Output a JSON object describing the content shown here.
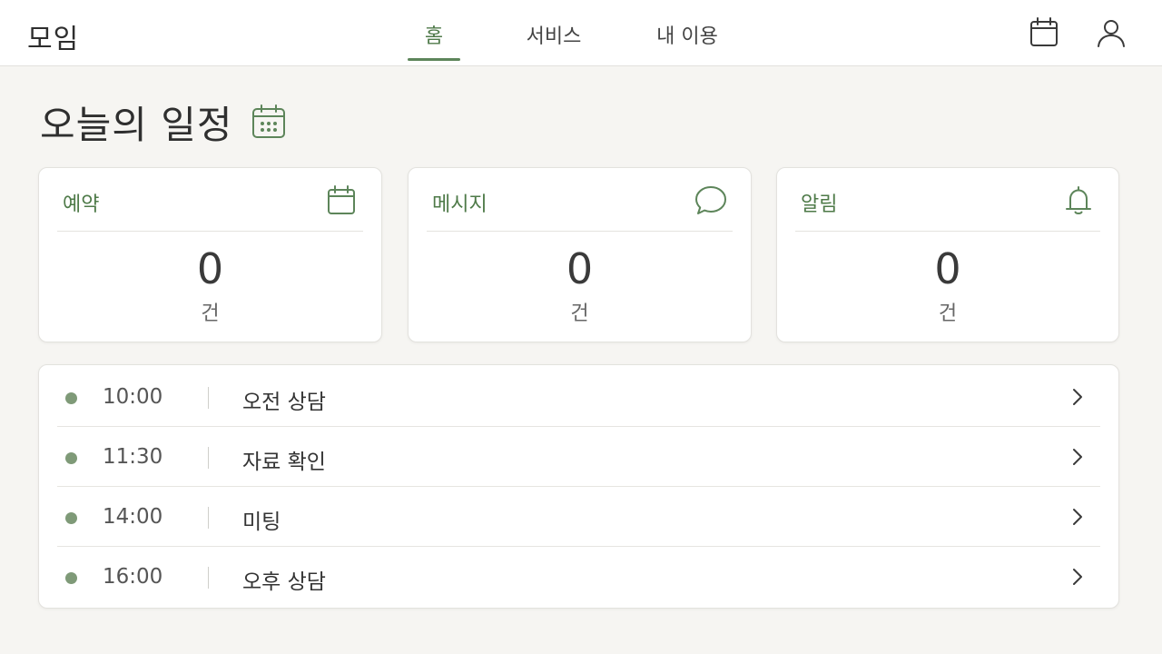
{
  "app": {
    "logo": "모임"
  },
  "nav": {
    "tabs": [
      {
        "label": "홈",
        "active": true
      },
      {
        "label": "서비스",
        "active": false
      },
      {
        "label": "내 이용",
        "active": false
      }
    ]
  },
  "header_icons": [
    "calendar-icon",
    "user-icon"
  ],
  "page": {
    "title": "오늘의 일정",
    "title_icon": "calendar-icon"
  },
  "cards": [
    {
      "label": "예약",
      "icon": "calendar-icon",
      "value": "0",
      "unit": "건"
    },
    {
      "label": "메시지",
      "icon": "chat-bubble-icon",
      "value": "0",
      "unit": "건"
    },
    {
      "label": "알림",
      "icon": "bell-icon",
      "value": "0",
      "unit": "건"
    }
  ],
  "schedule": [
    {
      "time": "10:00",
      "title": "오전 상담"
    },
    {
      "time": "11:30",
      "title": "자료 확인"
    },
    {
      "time": "14:00",
      "title": "미팅"
    },
    {
      "time": "16:00",
      "title": "오후 상담"
    }
  ],
  "colors": {
    "accent": "#5d855a",
    "background": "#f6f5f2",
    "dot": "#7f9a78"
  }
}
